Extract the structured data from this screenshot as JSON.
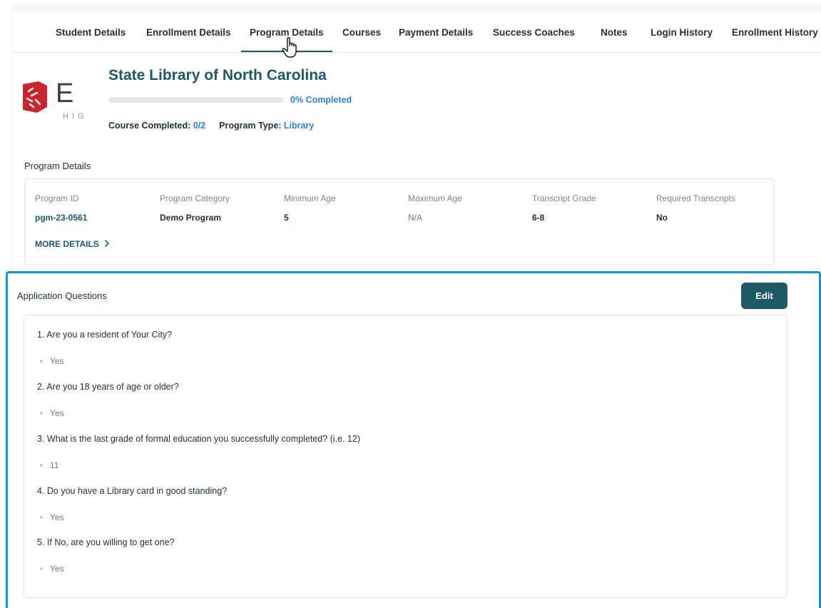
{
  "tabs": [
    {
      "label": "Student Details"
    },
    {
      "label": "Enrollment Details"
    },
    {
      "label": "Program Details",
      "active": true
    },
    {
      "label": "Courses"
    },
    {
      "label": "Payment Details"
    },
    {
      "label": "Success Coaches"
    },
    {
      "label": "Notes"
    },
    {
      "label": "Login History"
    },
    {
      "label": "Enrollment History"
    }
  ],
  "logo": {
    "letter": "E",
    "sub": "HIG"
  },
  "program": {
    "title": "State Library of North Carolina",
    "progress_percent": 0,
    "progress_label": "0% Completed",
    "course_completed_label": "Course Completed:",
    "course_completed_value": "0/2",
    "program_type_label": "Program Type:",
    "program_type_value": "Library"
  },
  "details": {
    "section_title": "Program Details",
    "columns": [
      {
        "header": "Program ID",
        "value": "pgm-23-0561"
      },
      {
        "header": "Program Category",
        "value": "Demo Program"
      },
      {
        "header": "Minimum Age",
        "value": "5"
      },
      {
        "header": "Maximum Age",
        "value": "N/A"
      },
      {
        "header": "Transcript Grade",
        "value": "6-8"
      },
      {
        "header": "Required Transcripts",
        "value": "No"
      }
    ],
    "more_link": "MORE DETAILS"
  },
  "application": {
    "section_title": "Application Questions",
    "edit_label": "Edit",
    "questions": [
      {
        "question": "1.  Are you a resident of Your City?",
        "answer": "Yes"
      },
      {
        "question": "2.  Are you 18 years of age or older?",
        "answer": "Yes"
      },
      {
        "question": "3.  What is the last grade of formal education you successfully completed? (i.e. 12)",
        "answer": "11"
      },
      {
        "question": "4.  Do you have a Library card in good standing?",
        "answer": "Yes"
      },
      {
        "question": "5.  If No, are you willing to get one?",
        "answer": "Yes"
      }
    ]
  },
  "colors": {
    "accent": "#1d5a66",
    "link": "#2f7fd6",
    "highlight": "#0f9ad6",
    "logo_red": "#c9252c"
  }
}
